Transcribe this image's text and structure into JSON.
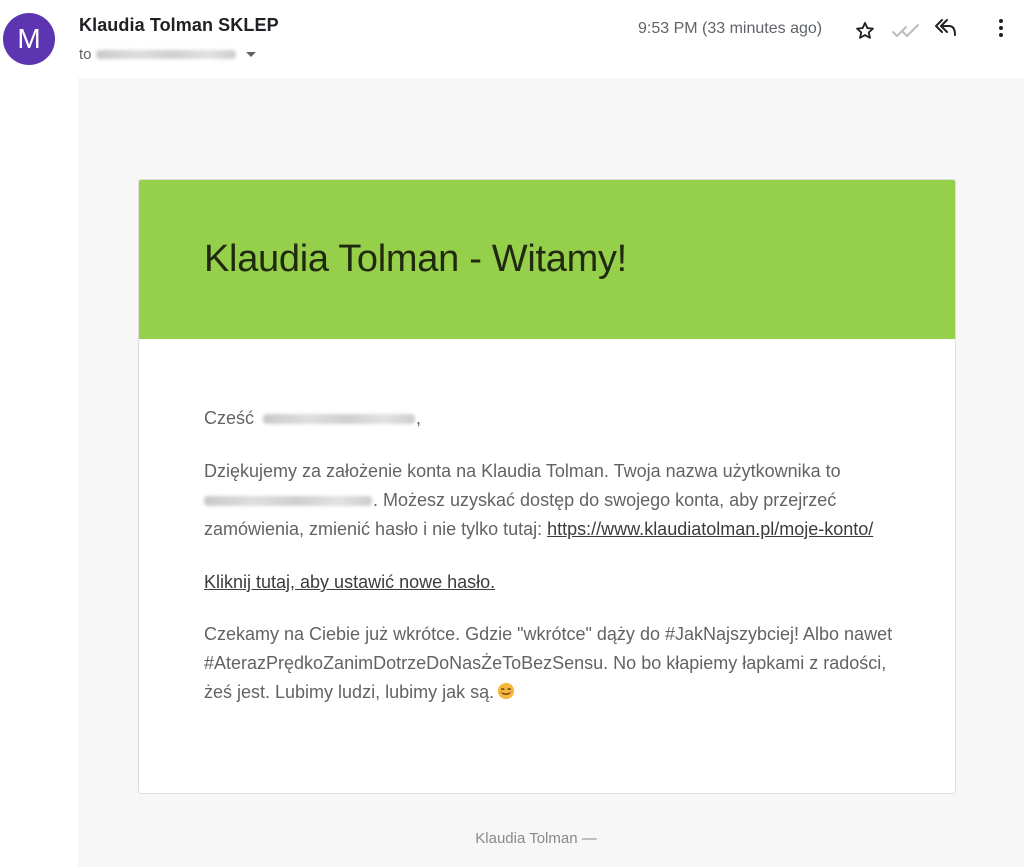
{
  "header": {
    "avatar_letter": "M",
    "sender_name": "Klaudia Tolman SKLEP",
    "to_label": "to",
    "timestamp": "9:53 PM (33 minutes ago)"
  },
  "icons": {
    "star": "star-outline-icon",
    "read": "double-check-icon",
    "reply": "reply-all-icon",
    "more": "more-vertical-icon",
    "emoji": "smiling-face-icon"
  },
  "colors": {
    "avatar": "#5e35b1",
    "banner": "#96d04b",
    "canvas": "#f7f7f7"
  },
  "email": {
    "title": "Klaudia Tolman - Witamy!",
    "greeting_prefix": "Cześć",
    "greeting_suffix": ",",
    "para1_a": "Dziękujemy za założenie konta na Klaudia Tolman. Twoja nazwa użytkownika to",
    "para1_b": ". Możesz uzyskać dostęp do swojego konta, aby przejrzeć zamówienia, zmienić hasło i nie tylko tutaj: ",
    "account_link": "https://www.klaudiatolman.pl/moje-konto/",
    "reset_link": "Kliknij tutaj, aby ustawić nowe hasło.",
    "para3": "Czekamy na Ciebie już wkrótce. Gdzie \"wkrótce\" dąży do #JakNajszybciej! Albo nawet #AterazPrędkoZanimDotrzeDoNasŻeToBezSensu. No bo kłapiemy łapkami z radości, żeś jest. Lubimy ludzi, lubimy jak są."
  },
  "footer": {
    "text": "Klaudia Tolman —"
  }
}
